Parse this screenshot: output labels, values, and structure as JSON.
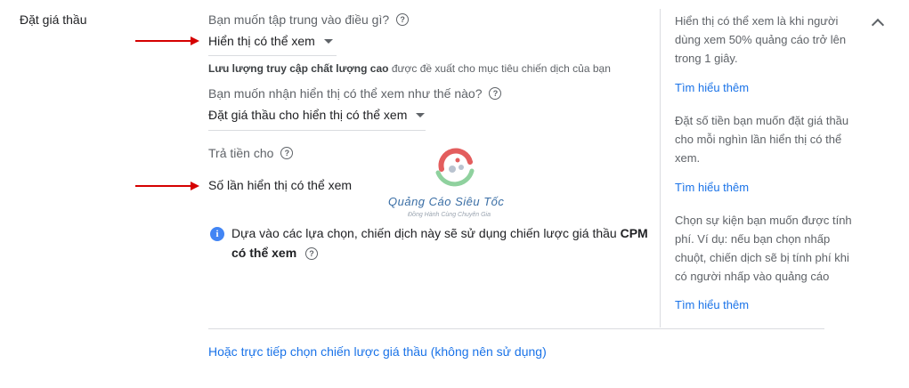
{
  "section": {
    "title": "Đặt giá thầu"
  },
  "focus": {
    "question": "Bạn muốn tập trung vào điều gì?",
    "value": "Hiển thị có thể xem",
    "hint_bold": "Lưu lượng truy cập chất lượng cao",
    "hint_rest": " được đề xuất cho mục tiêu chiến dịch của bạn"
  },
  "viewable": {
    "question": "Bạn muốn nhận hiển thị có thể xem như thế nào?",
    "value": "Đặt giá thầu cho hiển thị có thể xem"
  },
  "pay": {
    "question": "Trả tiền cho",
    "value": "Số lần hiển thị có thể xem"
  },
  "info": {
    "text": "Dựa vào các lựa chọn, chiến dịch này sẽ sử dụng chiến lược giá thầu ",
    "bold": "CPM có thể xem"
  },
  "sidebar": {
    "blocks": [
      {
        "text": "Hiển thị có thể xem là khi người dùng xem 50% quảng cáo trở lên trong 1 giây.",
        "link": "Tìm hiểu thêm"
      },
      {
        "text": "Đặt số tiền bạn muốn đặt giá thầu cho mỗi nghìn lần hiển thị có thể xem.",
        "link": "Tìm hiểu thêm"
      },
      {
        "text": "Chọn sự kiện bạn muốn được tính phí. Ví dụ: nếu bạn chọn nhấp chuột, chiến dịch sẽ bị tính phí khi có người nhấp vào quảng cáo",
        "link": "Tìm hiểu thêm"
      }
    ]
  },
  "bottom_link": "Hoặc trực tiếp chọn chiến lược giá thầu (không nên sử dụng)",
  "watermark": {
    "title": "Quảng Cáo Siêu Tốc",
    "subtitle": "Đồng Hành Cùng Chuyên Gia"
  },
  "icons": {
    "help": "help-circle-icon",
    "info": "info-icon",
    "collapse": "chevron-up-icon",
    "dropdown": "caret-down-icon"
  },
  "colors": {
    "link": "#1a73e8",
    "arrow": "#d50000",
    "info": "#4285f4"
  }
}
